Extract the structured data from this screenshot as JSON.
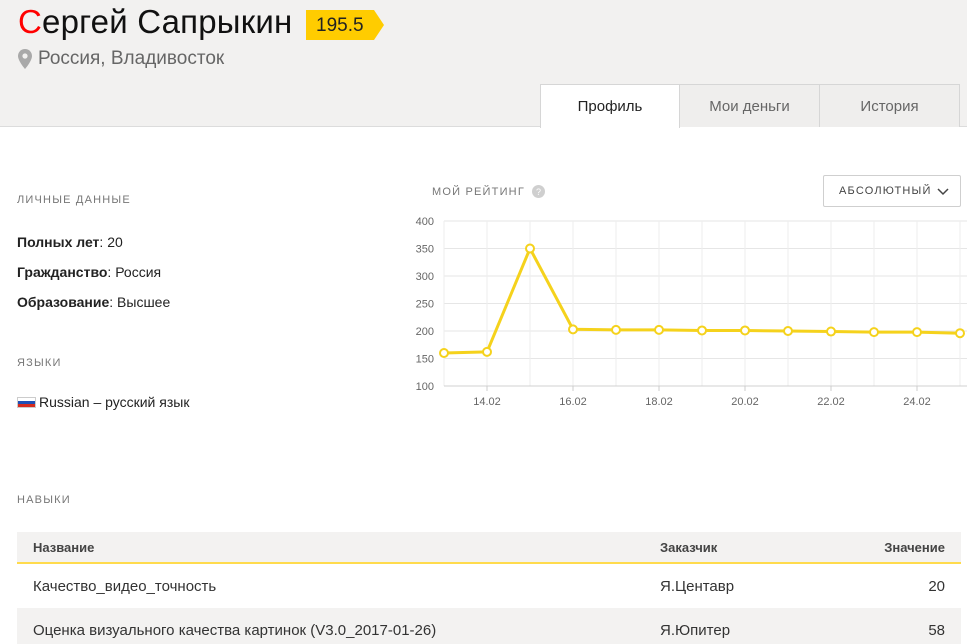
{
  "profile": {
    "name_first_letter": "С",
    "name_rest": "ергей Сапрыкин",
    "rating": "195.5",
    "location": "Россия, Владивосток",
    "icons": {
      "location": "map-pin-icon"
    }
  },
  "tabs": [
    {
      "label": "Профиль",
      "active": true
    },
    {
      "label": "Мои деньги",
      "active": false
    },
    {
      "label": "История",
      "active": false
    }
  ],
  "personal": {
    "title": "ЛИЧНЫЕ ДАННЫЕ",
    "age_label": "Полных лет",
    "age_value": ": 20",
    "citizenship_label": "Гражданство",
    "citizenship_value": ": Россия",
    "education_label": "Образование",
    "education_value": ": Высшее"
  },
  "languages": {
    "title": "ЯЗЫКИ",
    "items": [
      {
        "label": "Russian – русский язык",
        "flag": "russia-flag-icon"
      }
    ]
  },
  "rating_panel": {
    "title": "МОЙ РЕЙТИНГ",
    "help_glyph": "?",
    "mode_value": "АБСОЛЮТНЫЙ"
  },
  "chart_data": {
    "type": "line",
    "x": [
      "13.02",
      "14.02",
      "15.02",
      "16.02",
      "17.02",
      "18.02",
      "19.02",
      "20.02",
      "21.02",
      "22.02",
      "23.02",
      "24.02",
      "25.02"
    ],
    "values": [
      160,
      162,
      350,
      203,
      202,
      202,
      201,
      201,
      200,
      199,
      198,
      198,
      196
    ],
    "x_tick_labels": [
      "14.02",
      "16.02",
      "18.02",
      "20.02",
      "22.02",
      "24.02"
    ],
    "y_ticks": [
      100,
      150,
      200,
      250,
      300,
      350,
      400
    ],
    "ylim": [
      100,
      400
    ],
    "grid": true,
    "line_color": "#f5d21c"
  },
  "skills": {
    "title": "НАВЫКИ",
    "columns": [
      "Название",
      "Заказчик",
      "Значение"
    ],
    "rows": [
      {
        "name": "Качество_видео_точность",
        "customer": "Я.Центавр",
        "value": "20"
      },
      {
        "name": "Оценка визуального качества картинок (V3.0_2017-01-26)",
        "customer": "Я.Юпитер",
        "value": "58"
      }
    ]
  }
}
